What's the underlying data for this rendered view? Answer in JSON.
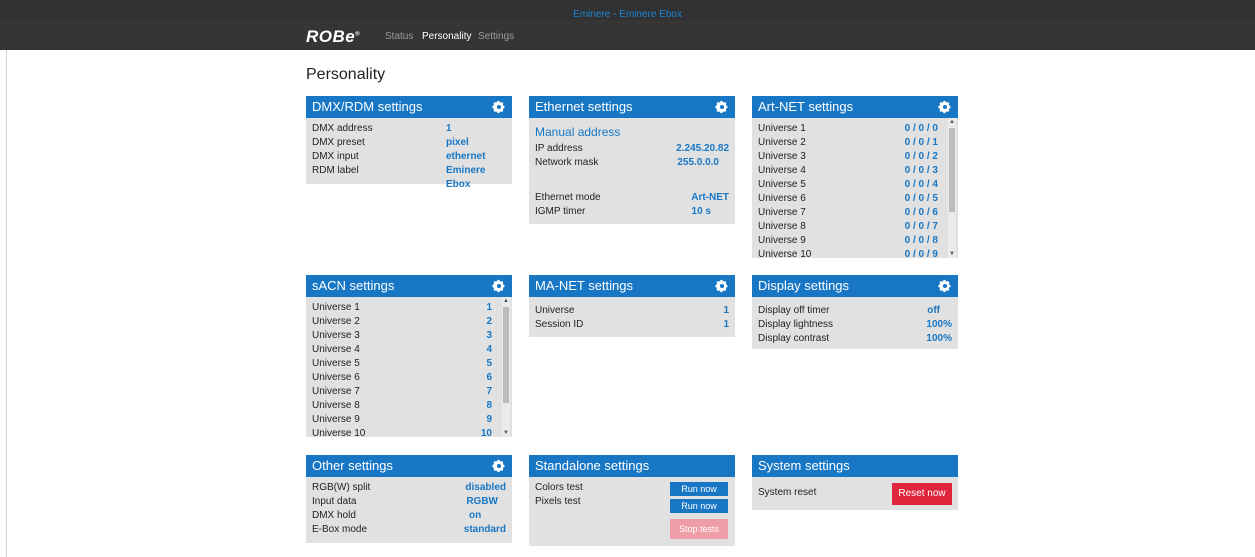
{
  "window_title": "Eminere - Eminere Ebox",
  "brand": "ROBe",
  "nav": {
    "status": "Status",
    "personality": "Personality",
    "settings": "Settings"
  },
  "page_title": "Personality",
  "colors": {
    "accent": "#1877c5",
    "panel": "#e1e1e1",
    "topbar": "#353536",
    "stop": "#ef9ea8",
    "reset": "#e0263d"
  },
  "icons": {
    "settings": "gear-icon",
    "scroll_up": "scroll-up-arrow",
    "scroll_down": "scroll-down-arrow"
  },
  "dmx": {
    "title": "DMX/RDM settings",
    "rows": [
      {
        "label": "DMX address",
        "value": "1"
      },
      {
        "label": "DMX preset",
        "value": "pixel"
      },
      {
        "label": "DMX input",
        "value": "ethernet"
      },
      {
        "label": "RDM label",
        "value": "Eminere Ebox"
      }
    ]
  },
  "ethernet": {
    "title": "Ethernet settings",
    "subtitle": "Manual address",
    "rows": [
      {
        "label": "IP address",
        "value": "2.245.20.82"
      },
      {
        "label": "Network mask",
        "value": "255.0.0.0"
      },
      {
        "label": "Ethernet mode",
        "value": "Art-NET"
      },
      {
        "label": "IGMP timer",
        "value": "10 s"
      }
    ]
  },
  "artnet": {
    "title": "Art-NET settings",
    "rows": [
      {
        "label": "Universe 1",
        "value": "0 / 0 / 0"
      },
      {
        "label": "Universe 2",
        "value": "0 / 0 / 1"
      },
      {
        "label": "Universe 3",
        "value": "0 / 0 / 2"
      },
      {
        "label": "Universe 4",
        "value": "0 / 0 / 3"
      },
      {
        "label": "Universe 5",
        "value": "0 / 0 / 4"
      },
      {
        "label": "Universe 6",
        "value": "0 / 0 / 5"
      },
      {
        "label": "Universe 7",
        "value": "0 / 0 / 6"
      },
      {
        "label": "Universe 8",
        "value": "0 / 0 / 7"
      },
      {
        "label": "Universe 9",
        "value": "0 / 0 / 8"
      },
      {
        "label": "Universe 10",
        "value": "0 / 0 / 9"
      }
    ]
  },
  "sacn": {
    "title": "sACN settings",
    "rows": [
      {
        "label": "Universe 1",
        "value": "1"
      },
      {
        "label": "Universe 2",
        "value": "2"
      },
      {
        "label": "Universe 3",
        "value": "3"
      },
      {
        "label": "Universe 4",
        "value": "4"
      },
      {
        "label": "Universe 5",
        "value": "5"
      },
      {
        "label": "Universe 6",
        "value": "6"
      },
      {
        "label": "Universe 7",
        "value": "7"
      },
      {
        "label": "Universe 8",
        "value": "8"
      },
      {
        "label": "Universe 9",
        "value": "9"
      },
      {
        "label": "Universe 10",
        "value": "10"
      }
    ]
  },
  "manet": {
    "title": "MA-NET settings",
    "rows": [
      {
        "label": "Universe",
        "value": "1"
      },
      {
        "label": "Session ID",
        "value": "1"
      }
    ]
  },
  "display": {
    "title": "Display settings",
    "rows": [
      {
        "label": "Display off timer",
        "value": "off"
      },
      {
        "label": "Display lightness",
        "value": "100%"
      },
      {
        "label": "Display contrast",
        "value": "100%"
      }
    ]
  },
  "other": {
    "title": "Other settings",
    "rows": [
      {
        "label": "RGB(W) split",
        "value": "disabled"
      },
      {
        "label": "Input data",
        "value": "RGBW"
      },
      {
        "label": "DMX hold",
        "value": "on"
      },
      {
        "label": "E-Box mode",
        "value": "standard"
      }
    ]
  },
  "standalone": {
    "title": "Standalone settings",
    "colors_test": "Colors test",
    "pixels_test": "Pixels test",
    "run_now": "Run now",
    "stop_tests": "Stop tests"
  },
  "system": {
    "title": "System settings",
    "reset_label": "System reset",
    "reset_button": "Reset now"
  }
}
